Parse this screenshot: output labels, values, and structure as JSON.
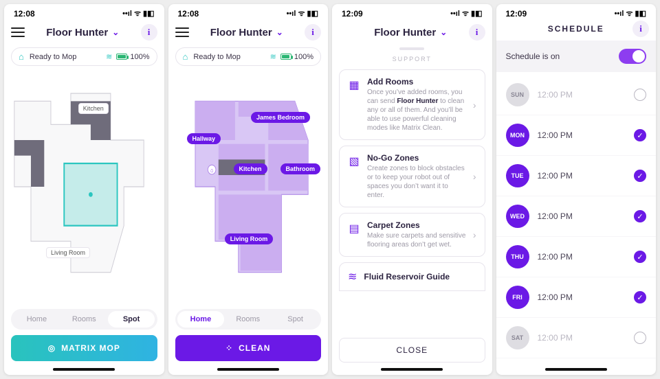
{
  "status_icons": "••ıl  ᯤ  ▮◧",
  "screens": {
    "a": {
      "time": "12:08",
      "title": "Floor Hunter",
      "ready": "Ready to Mop",
      "battery": "100%",
      "labels": {
        "kitchen": "Kitchen",
        "living_room": "Living Room"
      },
      "seg": {
        "home": "Home",
        "rooms": "Rooms",
        "spot": "Spot"
      },
      "cta": "MATRIX MOP"
    },
    "b": {
      "time": "12:08",
      "title": "Floor Hunter",
      "ready": "Ready to Mop",
      "battery": "100%",
      "rooms": {
        "hallway": "Hallway",
        "kitchen": "Kitchen",
        "james": "James Bedroom",
        "bath": "Bathroom",
        "living": "Living Room"
      },
      "seg": {
        "home": "Home",
        "rooms": "Rooms",
        "spot": "Spot"
      },
      "cta": "CLEAN"
    },
    "c": {
      "time": "12:09",
      "title": "Floor Hunter",
      "sheet_title": "SUPPORT",
      "cards": [
        {
          "title": "Add Rooms",
          "text_pre": "Once you’ve added rooms, you can send ",
          "text_bold": "Floor Hunter",
          "text_post": " to clean any or all of them. And you’ll be able to use powerful cleaning modes like Matrix Clean."
        },
        {
          "title": "No-Go Zones",
          "text": "Create zones to block obstacles or to keep your robot out of spaces you don’t want it to enter."
        },
        {
          "title": "Carpet Zones",
          "text": "Make sure carpets and sensitive flooring areas don’t get wet."
        }
      ],
      "fluid_title": "Fluid Reservoir Guide",
      "close": "CLOSE"
    },
    "d": {
      "time": "12:09",
      "title": "SCHEDULE",
      "toggle_label": "Schedule is on",
      "days": [
        {
          "abbr": "SUN",
          "time": "12:00 PM",
          "on": false
        },
        {
          "abbr": "MON",
          "time": "12:00 PM",
          "on": true
        },
        {
          "abbr": "TUE",
          "time": "12:00 PM",
          "on": true
        },
        {
          "abbr": "WED",
          "time": "12:00 PM",
          "on": true
        },
        {
          "abbr": "THU",
          "time": "12:00 PM",
          "on": true
        },
        {
          "abbr": "FRI",
          "time": "12:00 PM",
          "on": true
        },
        {
          "abbr": "SAT",
          "time": "12:00 PM",
          "on": false
        }
      ]
    }
  }
}
